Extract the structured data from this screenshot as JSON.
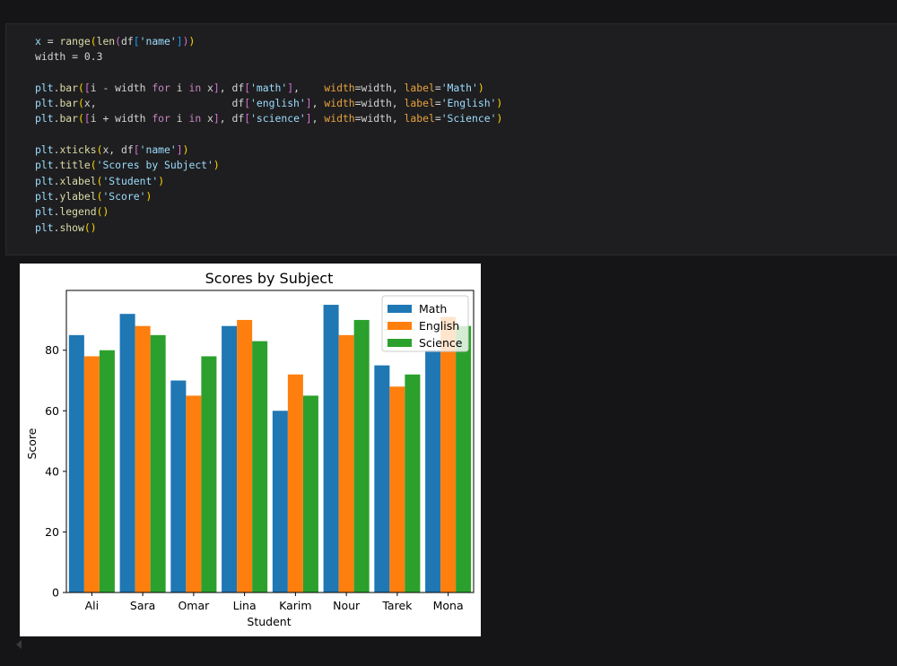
{
  "code_cell": {
    "lines": [
      [
        {
          "t": "x",
          "c": "var"
        },
        {
          "t": " = ",
          "c": "plain"
        },
        {
          "t": "range",
          "c": "builtin"
        },
        {
          "t": "(",
          "c": "bracket1"
        },
        {
          "t": "len",
          "c": "builtin"
        },
        {
          "t": "(",
          "c": "bracket2"
        },
        {
          "t": "df",
          "c": "plain"
        },
        {
          "t": "[",
          "c": "bracket3"
        },
        {
          "t": "'name'",
          "c": "var"
        },
        {
          "t": "]",
          "c": "bracket3"
        },
        {
          "t": ")",
          "c": "bracket2"
        },
        {
          "t": ")",
          "c": "bracket1"
        }
      ],
      [
        {
          "t": "width = 0.3",
          "c": "plain"
        }
      ],
      [],
      [
        {
          "t": "plt",
          "c": "var"
        },
        {
          "t": ".",
          "c": "plain"
        },
        {
          "t": "bar",
          "c": "func"
        },
        {
          "t": "(",
          "c": "bracket1"
        },
        {
          "t": "[",
          "c": "bracket2"
        },
        {
          "t": "i - width ",
          "c": "plain"
        },
        {
          "t": "for",
          "c": "keyword"
        },
        {
          "t": " i ",
          "c": "plain"
        },
        {
          "t": "in",
          "c": "keyword"
        },
        {
          "t": " x",
          "c": "plain"
        },
        {
          "t": "]",
          "c": "bracket2"
        },
        {
          "t": ", df",
          "c": "plain"
        },
        {
          "t": "[",
          "c": "bracket2"
        },
        {
          "t": "'math'",
          "c": "var"
        },
        {
          "t": "]",
          "c": "bracket2"
        },
        {
          "t": ",    ",
          "c": "plain"
        },
        {
          "t": "width",
          "c": "param"
        },
        {
          "t": "=width, ",
          "c": "plain"
        },
        {
          "t": "label",
          "c": "param"
        },
        {
          "t": "=",
          "c": "plain"
        },
        {
          "t": "'Math'",
          "c": "var"
        },
        {
          "t": ")",
          "c": "bracket1"
        }
      ],
      [
        {
          "t": "plt",
          "c": "var"
        },
        {
          "t": ".",
          "c": "plain"
        },
        {
          "t": "bar",
          "c": "func"
        },
        {
          "t": "(",
          "c": "bracket1"
        },
        {
          "t": "x,                      df",
          "c": "plain"
        },
        {
          "t": "[",
          "c": "bracket2"
        },
        {
          "t": "'english'",
          "c": "var"
        },
        {
          "t": "]",
          "c": "bracket2"
        },
        {
          "t": ", ",
          "c": "plain"
        },
        {
          "t": "width",
          "c": "param"
        },
        {
          "t": "=width, ",
          "c": "plain"
        },
        {
          "t": "label",
          "c": "param"
        },
        {
          "t": "=",
          "c": "plain"
        },
        {
          "t": "'English'",
          "c": "var"
        },
        {
          "t": ")",
          "c": "bracket1"
        }
      ],
      [
        {
          "t": "plt",
          "c": "var"
        },
        {
          "t": ".",
          "c": "plain"
        },
        {
          "t": "bar",
          "c": "func"
        },
        {
          "t": "(",
          "c": "bracket1"
        },
        {
          "t": "[",
          "c": "bracket2"
        },
        {
          "t": "i + width ",
          "c": "plain"
        },
        {
          "t": "for",
          "c": "keyword"
        },
        {
          "t": " i ",
          "c": "plain"
        },
        {
          "t": "in",
          "c": "keyword"
        },
        {
          "t": " x",
          "c": "plain"
        },
        {
          "t": "]",
          "c": "bracket2"
        },
        {
          "t": ", df",
          "c": "plain"
        },
        {
          "t": "[",
          "c": "bracket2"
        },
        {
          "t": "'science'",
          "c": "var"
        },
        {
          "t": "]",
          "c": "bracket2"
        },
        {
          "t": ", ",
          "c": "plain"
        },
        {
          "t": "width",
          "c": "param"
        },
        {
          "t": "=width, ",
          "c": "plain"
        },
        {
          "t": "label",
          "c": "param"
        },
        {
          "t": "=",
          "c": "plain"
        },
        {
          "t": "'Science'",
          "c": "var"
        },
        {
          "t": ")",
          "c": "bracket1"
        }
      ],
      [],
      [
        {
          "t": "plt",
          "c": "var"
        },
        {
          "t": ".",
          "c": "plain"
        },
        {
          "t": "xticks",
          "c": "func"
        },
        {
          "t": "(",
          "c": "bracket1"
        },
        {
          "t": "x, df",
          "c": "plain"
        },
        {
          "t": "[",
          "c": "bracket2"
        },
        {
          "t": "'name'",
          "c": "var"
        },
        {
          "t": "]",
          "c": "bracket2"
        },
        {
          "t": ")",
          "c": "bracket1"
        }
      ],
      [
        {
          "t": "plt",
          "c": "var"
        },
        {
          "t": ".",
          "c": "plain"
        },
        {
          "t": "title",
          "c": "func"
        },
        {
          "t": "(",
          "c": "bracket1"
        },
        {
          "t": "'Scores by Subject'",
          "c": "var"
        },
        {
          "t": ")",
          "c": "bracket1"
        }
      ],
      [
        {
          "t": "plt",
          "c": "var"
        },
        {
          "t": ".",
          "c": "plain"
        },
        {
          "t": "xlabel",
          "c": "func"
        },
        {
          "t": "(",
          "c": "bracket1"
        },
        {
          "t": "'Student'",
          "c": "var"
        },
        {
          "t": ")",
          "c": "bracket1"
        }
      ],
      [
        {
          "t": "plt",
          "c": "var"
        },
        {
          "t": ".",
          "c": "plain"
        },
        {
          "t": "ylabel",
          "c": "func"
        },
        {
          "t": "(",
          "c": "bracket1"
        },
        {
          "t": "'Score'",
          "c": "var"
        },
        {
          "t": ")",
          "c": "bracket1"
        }
      ],
      [
        {
          "t": "plt",
          "c": "var"
        },
        {
          "t": ".",
          "c": "plain"
        },
        {
          "t": "legend",
          "c": "func"
        },
        {
          "t": "()",
          "c": "bracket1"
        }
      ],
      [
        {
          "t": "plt",
          "c": "var"
        },
        {
          "t": ".",
          "c": "plain"
        },
        {
          "t": "show",
          "c": "func"
        },
        {
          "t": "()",
          "c": "bracket1"
        }
      ]
    ]
  },
  "colors": {
    "background": "#151517",
    "cell_background": "#1e1e20",
    "math": "#1f77b4",
    "english": "#ff7f0e",
    "science": "#2ca02c"
  },
  "chart_data": {
    "type": "bar",
    "title": "Scores by Subject",
    "xlabel": "Student",
    "ylabel": "Score",
    "categories": [
      "Ali",
      "Sara",
      "Omar",
      "Lina",
      "Karim",
      "Nour",
      "Tarek",
      "Mona"
    ],
    "series": [
      {
        "name": "Math",
        "color": "#1f77b4",
        "values": [
          85,
          92,
          70,
          88,
          60,
          95,
          75,
          80
        ]
      },
      {
        "name": "English",
        "color": "#ff7f0e",
        "values": [
          78,
          88,
          65,
          90,
          72,
          85,
          68,
          91
        ]
      },
      {
        "name": "Science",
        "color": "#2ca02c",
        "values": [
          80,
          85,
          78,
          83,
          65,
          90,
          72,
          88
        ]
      }
    ],
    "yticks": [
      0,
      20,
      40,
      60,
      80
    ],
    "ylim": [
      0,
      99.75
    ],
    "legend_position": "upper right",
    "grid": false
  }
}
